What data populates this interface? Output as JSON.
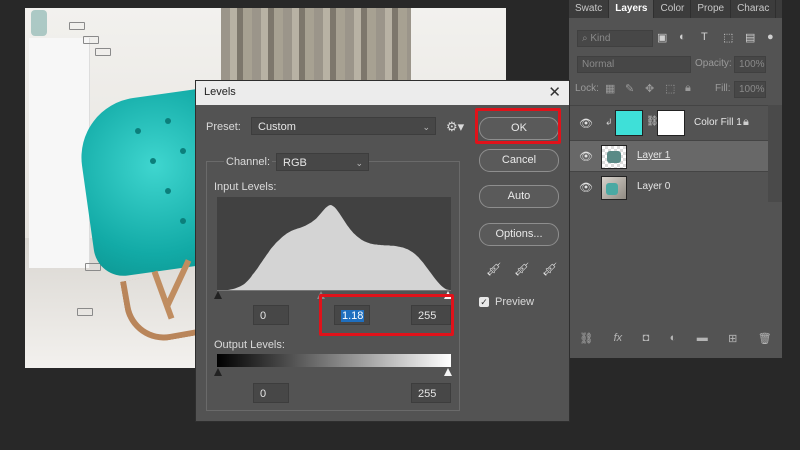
{
  "dialog": {
    "title": "Levels",
    "preset_label": "Preset:",
    "preset_value": "Custom",
    "channel_label": "Channel:",
    "channel_value": "RGB",
    "input_levels_label": "Input Levels:",
    "input_black": "0",
    "input_gamma": "1.18",
    "input_white": "255",
    "output_levels_label": "Output Levels:",
    "output_black": "0",
    "output_white": "255",
    "buttons": {
      "ok": "OK",
      "cancel": "Cancel",
      "auto": "Auto",
      "options": "Options..."
    },
    "preview_label": "Preview",
    "preview_checked": true,
    "icons": {
      "close": "close-icon",
      "gear": "gear-icon",
      "eyedropper": "eyedropper-icon"
    },
    "highlight_color": "#e0121a"
  },
  "layers_panel": {
    "tabs": [
      "Swatc",
      "Layers",
      "Color",
      "Prope",
      "Charac"
    ],
    "active_tab": "Layers",
    "kind_filter": "Kind",
    "blend_mode": "Normal",
    "opacity_label": "Opacity:",
    "opacity_value": "100%",
    "lock_label": "Lock:",
    "fill_label": "Fill:",
    "fill_value": "100%",
    "layers": [
      {
        "name": "Color Fill 1",
        "type": "fill",
        "color": "#3ee0d8",
        "selected": false
      },
      {
        "name": "Layer 1",
        "type": "image",
        "selected": true
      },
      {
        "name": "Layer 0",
        "type": "image",
        "selected": false
      }
    ]
  },
  "histogram": {
    "levels": [
      0,
      0,
      0,
      0,
      0,
      0,
      0,
      0,
      1,
      2,
      3,
      4,
      6,
      8,
      10,
      12,
      15,
      18,
      22,
      27,
      32,
      38,
      44,
      52,
      58,
      65,
      72,
      80,
      88,
      95,
      103,
      110,
      118,
      125,
      133,
      140,
      146,
      152,
      158,
      163,
      168,
      173,
      178,
      182,
      186,
      190,
      193,
      196,
      199,
      201,
      203,
      205,
      207,
      208,
      210,
      212,
      214,
      216,
      219,
      222,
      225,
      228,
      232,
      236,
      240,
      246,
      252,
      258,
      264,
      270,
      276,
      280,
      284,
      286,
      285,
      282,
      278,
      272,
      265,
      258,
      250,
      242,
      234,
      226,
      218,
      211,
      204,
      198,
      192,
      187,
      182,
      178,
      174,
      170,
      167,
      164,
      162,
      160,
      158,
      156,
      155,
      154,
      153,
      153,
      152,
      152,
      151,
      151,
      150,
      150,
      150,
      150,
      149,
      149,
      149,
      148,
      147,
      146,
      145,
      144,
      143,
      141,
      139,
      137,
      134,
      131,
      128,
      124,
      120,
      115,
      110,
      104,
      98,
      92,
      85,
      78,
      71,
      64,
      57,
      50,
      43,
      36,
      30,
      24,
      18,
      13,
      9,
      5,
      2,
      1,
      0,
      0
    ]
  }
}
